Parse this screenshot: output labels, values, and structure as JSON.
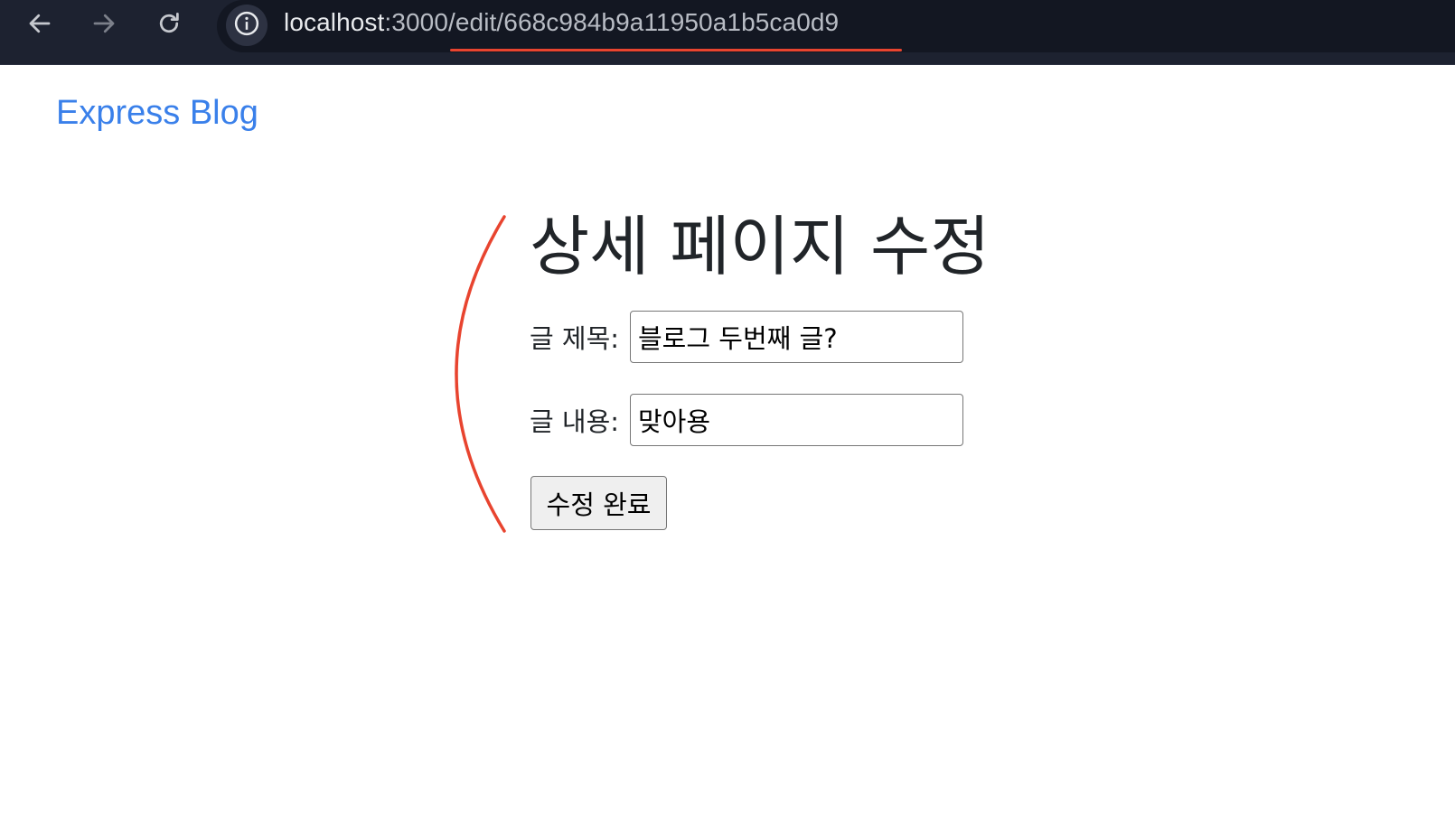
{
  "browser": {
    "url_host": "localhost",
    "url_rest": ":3000/edit/668c984b9a11950a1b5ca0d9",
    "icons": {
      "back": "arrow-left-icon",
      "forward": "arrow-right-icon",
      "reload": "reload-icon",
      "site_info": "info-icon"
    },
    "colors": {
      "toolbar_bg": "#1d2230",
      "omnibox_bg": "#131722",
      "underline": "#e8442f"
    }
  },
  "nav": {
    "brand": "Express Blog"
  },
  "page": {
    "heading": "상세 페이지 수정",
    "form": {
      "title_label": "글 제목:",
      "title_value": "블로그 두번째 글?",
      "content_label": "글 내용:",
      "content_value": "맞아용",
      "submit_label": "수정 완료"
    }
  },
  "colors": {
    "brand_link": "#3a80ea",
    "annotation": "#e8442f",
    "text": "#212529"
  }
}
